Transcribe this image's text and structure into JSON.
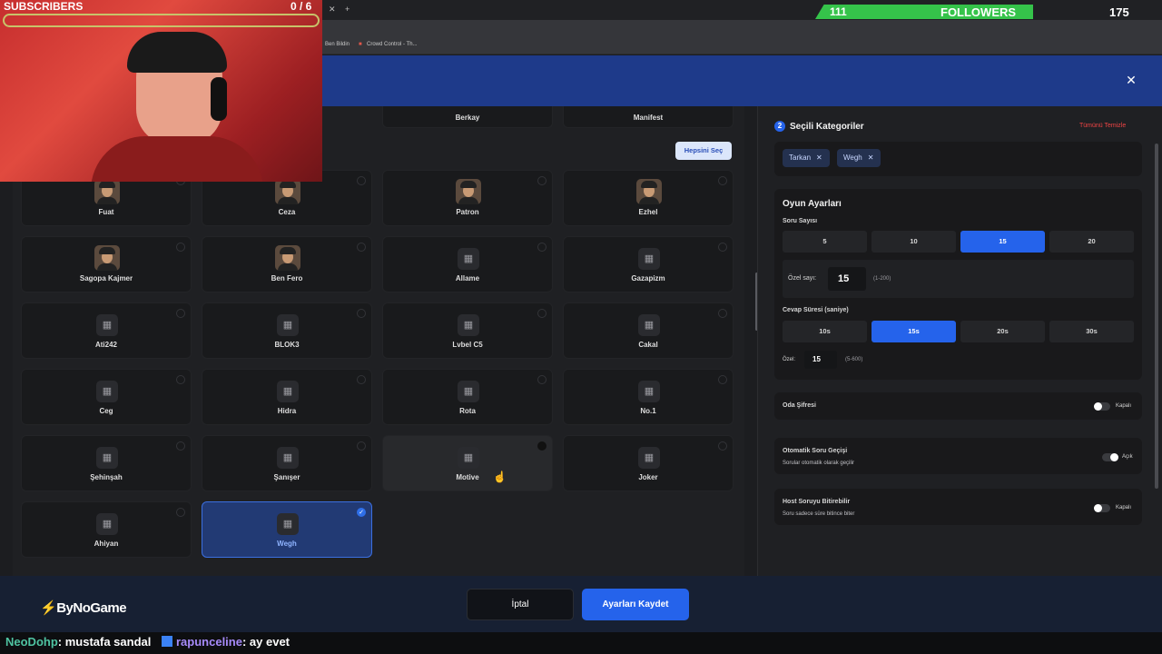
{
  "overlay": {
    "subscribers_label": "SUBSCRIBERS",
    "subscribers_count": "0  / 6",
    "followers_current": "111",
    "followers_label": "FOLLOWERS",
    "followers_goal": "175"
  },
  "browser": {
    "bookmarks": [
      "Ben Bildin",
      "Crowd Control - Th..."
    ]
  },
  "categories": {
    "select_all_label": "Hepsini Seç",
    "top_row_partial": [
      "Berkay",
      "Manifest"
    ],
    "items": [
      {
        "label": "Fuat",
        "avatar": true
      },
      {
        "label": "Ceza",
        "avatar": true
      },
      {
        "label": "Patron",
        "avatar": true
      },
      {
        "label": "Ezhel",
        "avatar": true
      },
      {
        "label": "Sagopa Kajmer",
        "avatar": true
      },
      {
        "label": "Ben Fero",
        "avatar": true
      },
      {
        "label": "Allame",
        "avatar": false
      },
      {
        "label": "Gazapizm",
        "avatar": false
      },
      {
        "label": "Ati242",
        "avatar": false
      },
      {
        "label": "BLOK3",
        "avatar": false
      },
      {
        "label": "Lvbel C5",
        "avatar": false
      },
      {
        "label": "Cakal",
        "avatar": false
      },
      {
        "label": "Ceg",
        "avatar": false
      },
      {
        "label": "Hidra",
        "avatar": false
      },
      {
        "label": "Rota",
        "avatar": false
      },
      {
        "label": "No.1",
        "avatar": false
      },
      {
        "label": "Şehinşah",
        "avatar": false
      },
      {
        "label": "Şanışer",
        "avatar": false
      },
      {
        "label": "Motive",
        "avatar": false
      },
      {
        "label": "Joker",
        "avatar": false
      },
      {
        "label": "Ahiyan",
        "avatar": false
      },
      {
        "label": "Wegh",
        "avatar": false
      }
    ]
  },
  "selected": {
    "step": "2",
    "title": "Seçili Kategoriler",
    "clear_all": "Tümünü Temizle",
    "chips": [
      "Tarkan",
      "Wegh"
    ]
  },
  "settings": {
    "title": "Oyun Ayarları",
    "question_count_label": "Soru Sayısı",
    "question_count_options": [
      "5",
      "10",
      "15",
      "20"
    ],
    "question_count_selected": "15",
    "custom_count_label": "Özel sayı:",
    "custom_count_value": "15",
    "custom_count_range": "(1-200)",
    "answer_time_label": "Cevap Süresi (saniye)",
    "answer_time_options": [
      "10s",
      "15s",
      "20s",
      "30s"
    ],
    "answer_time_selected": "15s",
    "custom_time_label": "Özel:",
    "custom_time_value": "15",
    "custom_time_range": "(5-600)"
  },
  "toggles": {
    "room_password": {
      "label": "Oda Şifresi",
      "state": "Kapalı"
    },
    "auto_next": {
      "label": "Otomatik Soru Geçişi",
      "desc": "Sorular otomatik olarak geçilir",
      "state": "Açık"
    },
    "host_end": {
      "label": "Host Soruyu Bitirebilir",
      "desc": "Soru sadece süre bitince biter",
      "state": "Kapalı"
    }
  },
  "footer": {
    "logo": "ByNoGame",
    "cancel": "İptal",
    "save": "Ayarları Kaydet"
  },
  "chat": {
    "user1": "NeoDohp",
    "msg1": ": mustafa sandal",
    "user2": "rapunceline",
    "msg2": ": ay evet"
  },
  "colors": {
    "accent": "#2563eb",
    "header": "#1e3a8a",
    "danger": "#ef4444",
    "followers_bar": "#35c34a"
  }
}
